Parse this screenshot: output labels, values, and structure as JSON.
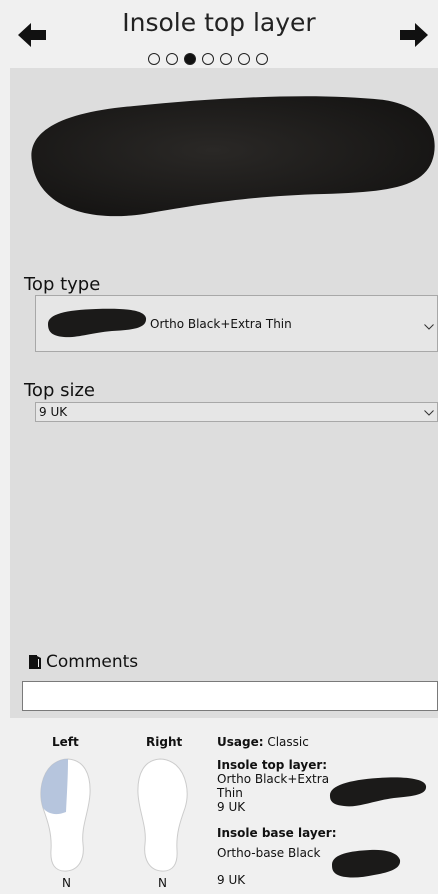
{
  "header": {
    "title": "Insole top layer",
    "steps_total": 7,
    "steps_active_index": 2
  },
  "top_type": {
    "label": "Top type",
    "value": "Ortho Black+Extra Thin"
  },
  "top_size": {
    "label": "Top size",
    "value": "9 UK"
  },
  "comments": {
    "label": "Comments",
    "value": ""
  },
  "summary": {
    "left_label": "Left",
    "right_label": "Right",
    "left_foot_code": "N",
    "right_foot_code": "N",
    "usage_label": "Usage:",
    "usage_value": "Classic",
    "top_layer_label": "Insole top layer:",
    "top_layer_line1": "Ortho Black+Extra",
    "top_layer_line2": "Thin",
    "top_layer_size": "9 UK",
    "base_layer_label": "Insole base layer:",
    "base_layer_value": "Ortho-base Black",
    "base_layer_size": "9 UK"
  },
  "colors": {
    "insole": "#1d1b1a",
    "panel": "#dddddd",
    "header": "#f0f0f0",
    "foot_highlight": "#aebfd9"
  }
}
